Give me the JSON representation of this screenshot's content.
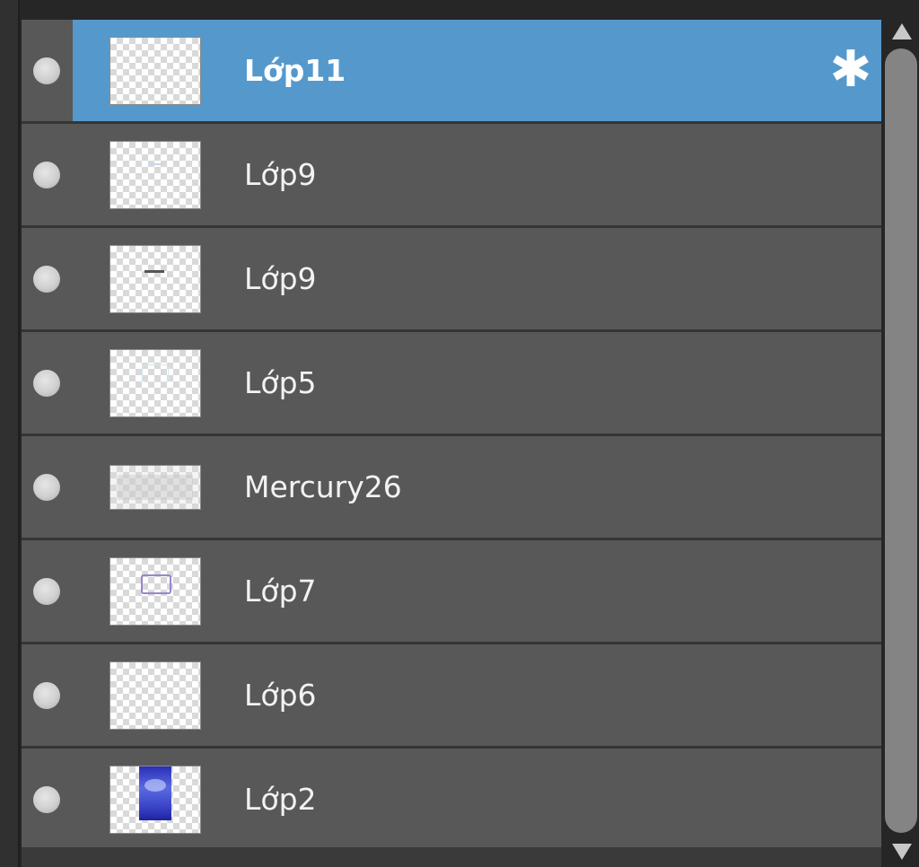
{
  "layers_panel": {
    "selected_index": 0,
    "layers": [
      {
        "name": "Lớp11",
        "selected": true,
        "visible": true,
        "thumbnail": "transparent"
      },
      {
        "name": "Lớp9",
        "selected": false,
        "visible": true,
        "thumbnail": "transparent-faint-blue-mark"
      },
      {
        "name": "Lớp9",
        "selected": false,
        "visible": true,
        "thumbnail": "transparent-dark-dash"
      },
      {
        "name": "Lớp5",
        "selected": false,
        "visible": true,
        "thumbnail": "transparent-faint-outline"
      },
      {
        "name": "Mercury26",
        "selected": false,
        "visible": true,
        "thumbnail": "wide-white-texture"
      },
      {
        "name": "Lớp7",
        "selected": false,
        "visible": true,
        "thumbnail": "transparent-purple-rectangle"
      },
      {
        "name": "Lớp6",
        "selected": false,
        "visible": true,
        "thumbnail": "transparent"
      },
      {
        "name": "Lớp2",
        "selected": false,
        "visible": true,
        "thumbnail": "blue-poster"
      }
    ],
    "settings_icon": "gear-icon"
  },
  "colors": {
    "panel_bg": "#585858",
    "selected_bg": "#5599cc",
    "divider": "#353535",
    "text": "#f2f2f2",
    "scrollbar_thumb": "#848484"
  }
}
